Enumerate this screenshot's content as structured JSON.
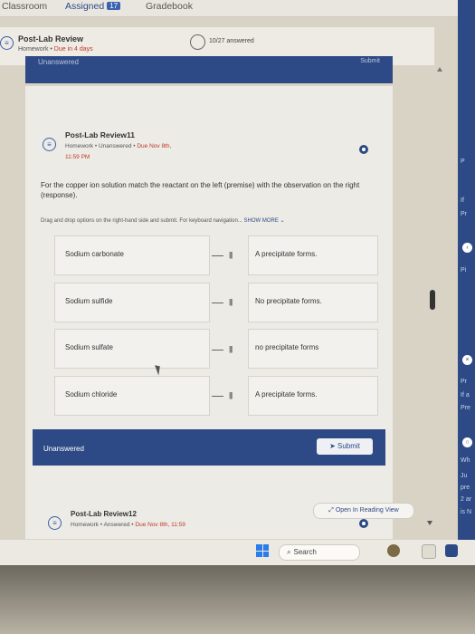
{
  "topnav": {
    "tab_classroom": "Classroom",
    "tab_assigned": "Assigned",
    "assigned_count": "17",
    "tab_gradebook": "Gradebook"
  },
  "header": {
    "title": "Post-Lab Review",
    "type": "Homework",
    "due": "Due in 4 days",
    "answered": "10/27 answered"
  },
  "top_bar": {
    "label": "Unanswered",
    "action": "Submit"
  },
  "question": {
    "title": "Post-Lab Review11",
    "type": "Homework",
    "status": "Unanswered",
    "due": "Due Nov 8th,",
    "time": "11:59 PM",
    "prompt": "For the copper ion solution match the reactant on the left (premise) with the observation on the right (response).",
    "instructions": "Drag and drop options on the right-hand side and submit. For keyboard navigation...",
    "show_more": "SHOW MORE"
  },
  "pairs": [
    {
      "premise": "Sodium carbonate",
      "response": "A precipitate forms."
    },
    {
      "premise": "Sodium sulfide",
      "response": "No precipitate forms."
    },
    {
      "premise": "Sodium sulfate",
      "response": "no precipitate forms"
    },
    {
      "premise": "Sodium chloride",
      "response": "A precipitate forms."
    }
  ],
  "footer_bar": {
    "status": "Unanswered",
    "submit_label": "Submit"
  },
  "next_question": {
    "title": "Post-Lab Review12",
    "type": "Homework",
    "status": "Answered",
    "due": "Due Nov 8th, 11:59",
    "reading_view": "Open In Reading View"
  },
  "taskbar": {
    "search_placeholder": "Search"
  },
  "right_panel": {
    "items": [
      "P",
      "If",
      "Pr",
      "Pi",
      "Pr",
      "If a",
      "Pre",
      "Wh",
      "Ju",
      "pre",
      "2 ar",
      "is N"
    ]
  },
  "colors": {
    "accent": "#2e4a86",
    "due": "#c0392b",
    "panel": "#ecebe6"
  }
}
